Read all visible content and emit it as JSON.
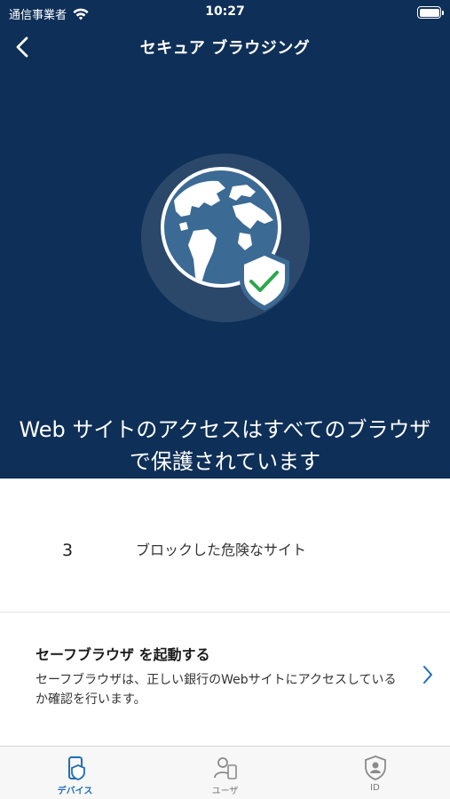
{
  "status_bar": {
    "carrier": "通信事業者",
    "time": "10:27"
  },
  "nav": {
    "title": "セキュア ブラウジング",
    "back_icon": "chevron-left-icon"
  },
  "hero": {
    "illustration_icon": "globe-shield-check-icon",
    "message": "Web サイトのアクセスはすべてのブラウザで保護されています"
  },
  "stats": {
    "count": "3",
    "label": "ブロックした危険なサイト"
  },
  "action": {
    "title": "セーフブラウザ を起動する",
    "description": "セーフブラウザは、正しい銀行のWebサイトにアクセスしているか確認を行います。",
    "chevron_icon": "chevron-right-icon"
  },
  "tabs": [
    {
      "label": "デバイス",
      "icon": "device-shield-icon",
      "active": true
    },
    {
      "label": "ユーザ",
      "icon": "user-device-icon",
      "active": false
    },
    {
      "label": "ID",
      "icon": "id-shield-icon",
      "active": false
    }
  ],
  "colors": {
    "hero_background": "#0e2f57",
    "accent": "#1f6fb7",
    "check_green": "#2aa84a"
  }
}
